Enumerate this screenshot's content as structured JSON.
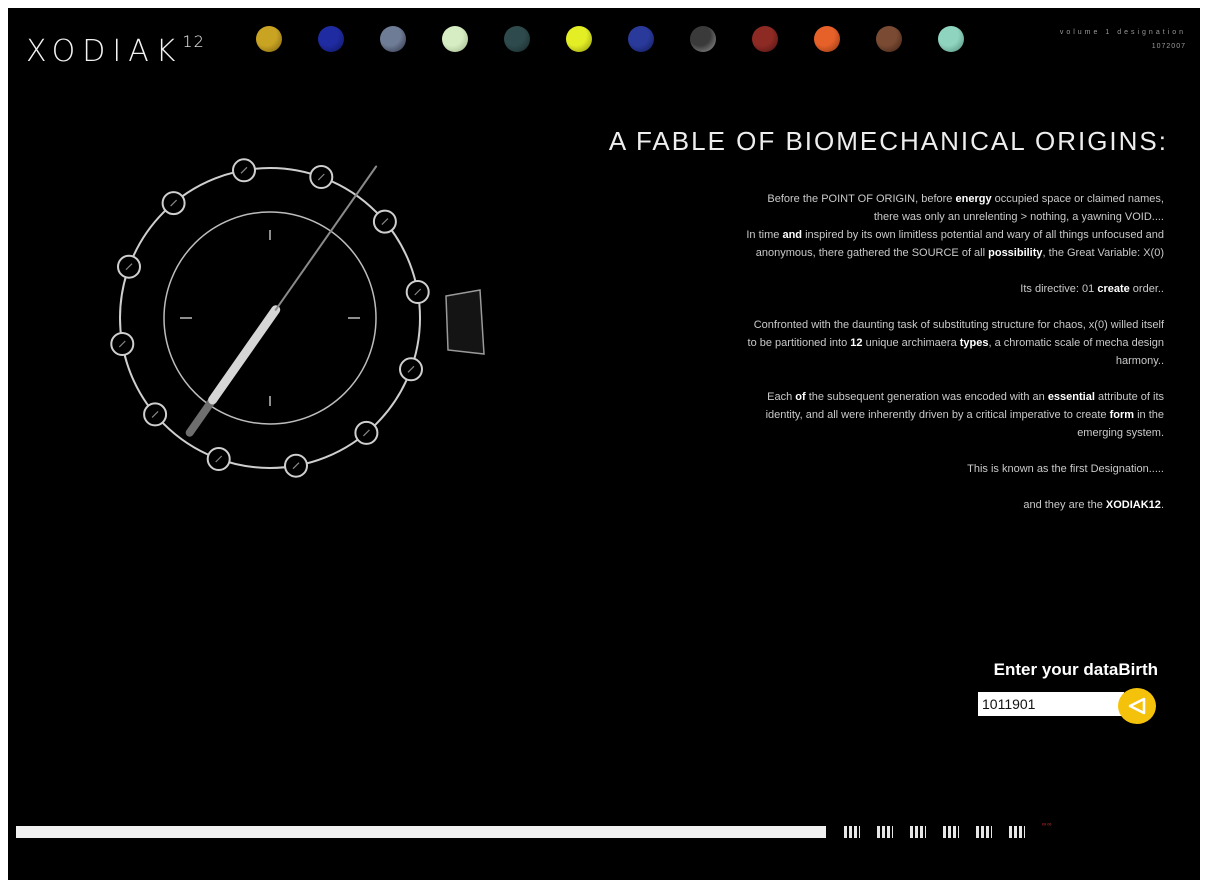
{
  "header": {
    "logo_text": "XODIAK",
    "logo_super": "12",
    "right_line1": "volume 1 designation",
    "right_line2": "1072007"
  },
  "orbs": [
    {
      "color": "#c9a423",
      "edge": "#7a5e10",
      "icon": "sign-orb-1"
    },
    {
      "color": "#1f2ba0",
      "edge": "#0d1560",
      "icon": "sign-orb-2"
    },
    {
      "color": "#6f7c95",
      "edge": "#2a3145",
      "icon": "sign-orb-3"
    },
    {
      "color": "#d6edc3",
      "edge": "#9cb28a",
      "icon": "sign-orb-4"
    },
    {
      "color": "#2f4a4c",
      "edge": "#15292a",
      "icon": "sign-orb-5"
    },
    {
      "color": "#e4ee25",
      "edge": "#8a9210",
      "icon": "sign-orb-6"
    },
    {
      "color": "#2a3a9a",
      "edge": "#11195a",
      "icon": "sign-orb-7"
    },
    {
      "color": "#3a3a3a",
      "edge": "#9a9a9a",
      "icon": "sign-orb-8"
    },
    {
      "color": "#8e2a24",
      "edge": "#4c1210",
      "icon": "sign-orb-9"
    },
    {
      "color": "#e6602a",
      "edge": "#8a3510",
      "icon": "sign-orb-10"
    },
    {
      "color": "#7a4a32",
      "edge": "#3c2214",
      "icon": "sign-orb-11"
    },
    {
      "color": "#8fd4bf",
      "edge": "#4f8a78",
      "icon": "sign-orb-12"
    }
  ],
  "headline": "A FABLE OF BIOMECHANICAL ORIGINS:",
  "story": {
    "p1": [
      {
        "t": "Before the POINT OF ORIGIN, before "
      },
      {
        "t": "energy",
        "b": true
      },
      {
        "t": " occupied space or claimed names, there was only an unrelenting > nothing, a yawning VOID...."
      }
    ],
    "p1b": [
      {
        "t": "In time "
      },
      {
        "t": "and",
        "b": true
      },
      {
        "t": " inspired by its own limitless potential and wary of all things unfocused and anonymous, there gathered the SOURCE of all "
      },
      {
        "t": "possibility",
        "b": true
      },
      {
        "t": ", the Great Variable: X(0)"
      }
    ],
    "p2": [
      {
        "t": "Its directive: 01 "
      },
      {
        "t": "create",
        "b": true
      },
      {
        "t": " order.."
      }
    ],
    "p3": [
      {
        "t": "Confronted with the daunting task of substituting structure for chaos, x(0) willed itself to be partitioned into "
      },
      {
        "t": "12",
        "b": true
      },
      {
        "t": " unique archimaera "
      },
      {
        "t": "types",
        "b": true
      },
      {
        "t": ", a chromatic scale of mecha design harmony.."
      }
    ],
    "p4": [
      {
        "t": "Each "
      },
      {
        "t": "of",
        "b": true
      },
      {
        "t": " the subsequent generation was encoded with an "
      },
      {
        "t": "essential",
        "b": true
      },
      {
        "t": " attribute of its identity, and all were inherently driven by a critical imperative to create "
      },
      {
        "t": "form",
        "b": true
      },
      {
        "t": " in the emerging system."
      }
    ],
    "p5": [
      {
        "t": "This is known as the first Designation....."
      }
    ],
    "p6": [
      {
        "t": "and they are the "
      },
      {
        "t": "XODIAK12",
        "b": true
      },
      {
        "t": "."
      }
    ]
  },
  "birth": {
    "label": "Enter your dataBirth",
    "value": "1011901",
    "go_icon": "triangle-left-icon"
  },
  "progress": {
    "fraction": 1.0
  },
  "chapters": 6,
  "tiny_red": "∞∞",
  "dial": {
    "ring_nodes": 12,
    "needle_angle_deg": 35
  }
}
